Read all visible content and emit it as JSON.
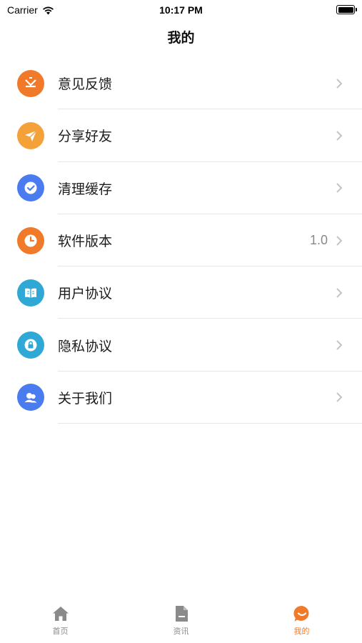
{
  "status_bar": {
    "carrier": "Carrier",
    "time": "10:17 PM"
  },
  "header": {
    "title": "我的"
  },
  "menu": [
    {
      "label": "意见反馈",
      "icon": "feedback-icon",
      "color": "#f07a2a",
      "value": ""
    },
    {
      "label": "分享好友",
      "icon": "share-plane-icon",
      "color": "#f5a13a",
      "value": ""
    },
    {
      "label": "清理缓存",
      "icon": "check-circle-icon",
      "color": "#4a7cf0",
      "value": ""
    },
    {
      "label": "软件版本",
      "icon": "clock-icon",
      "color": "#f07a2a",
      "value": "1.0"
    },
    {
      "label": "用户协议",
      "icon": "book-icon",
      "color": "#2fa8d6",
      "value": ""
    },
    {
      "label": "隐私协议",
      "icon": "lock-icon",
      "color": "#2fa8d6",
      "value": ""
    },
    {
      "label": "关于我们",
      "icon": "users-icon",
      "color": "#4a7cf0",
      "value": ""
    }
  ],
  "tabs": [
    {
      "label": "首页",
      "icon": "home-icon",
      "active": false
    },
    {
      "label": "资讯",
      "icon": "document-icon",
      "active": false
    },
    {
      "label": "我的",
      "icon": "chat-bubble-icon",
      "active": true
    }
  ],
  "colors": {
    "accent": "#f07a2a",
    "inactive_tab": "#8a8a8a"
  }
}
